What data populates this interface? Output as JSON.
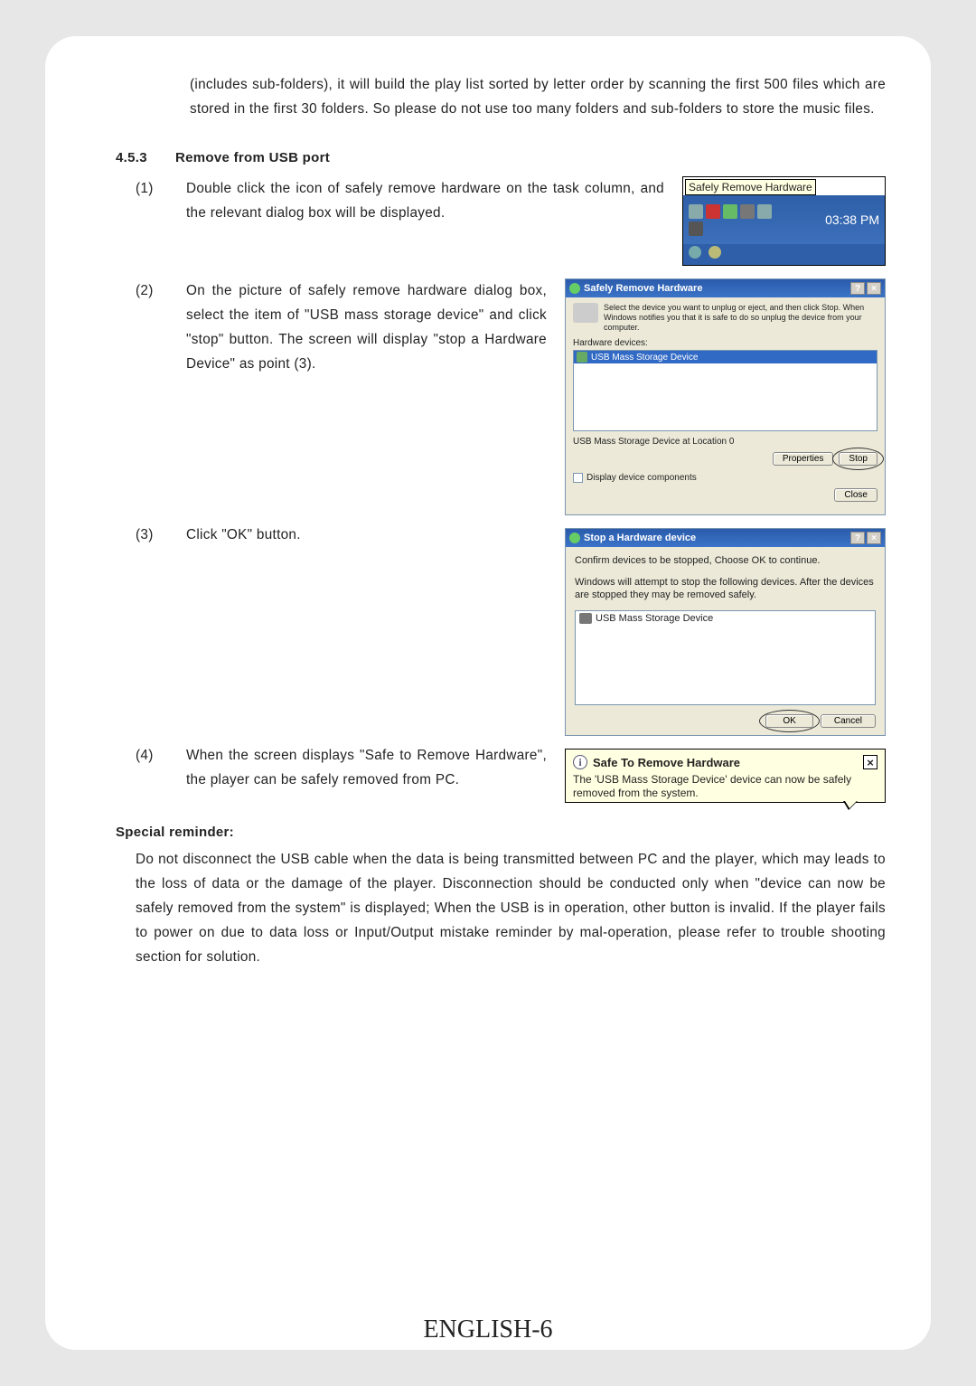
{
  "intro": "(includes sub-folders), it will build the play list sorted by letter order by scanning the first 500 files which are stored in the first 30 folders. So please do not use too many folders and sub-folders to store the music files.",
  "section": {
    "num": "4.5.3",
    "title": "Remove from USB port"
  },
  "steps": {
    "s1_num": "(1)",
    "s1": "Double click the icon of safely remove hardware on the task column, and the relevant dialog box will be displayed.",
    "s2_num": "(2)",
    "s2": "On the picture of safely remove hardware dialog box, select the item of \"USB mass storage device\" and click \"stop\" button. The screen will display \"stop a Hardware Device\" as point (3).",
    "s3_num": "(3)",
    "s3": "Click \"OK\" button.",
    "s4_num": "(4)",
    "s4": "When the screen displays \"Safe to Remove Hardware\", the player can be safely removed from PC."
  },
  "tray": {
    "tooltip": "Safely Remove Hardware",
    "clock": "03:38 PM"
  },
  "srh": {
    "title": "Safely Remove Hardware",
    "help": "Select the device you want to unplug or eject, and then click Stop. When Windows notifies you that it is safe to do so unplug the device from your computer.",
    "label": "Hardware devices:",
    "item": "USB Mass Storage Device",
    "status": "USB Mass Storage Device at Location 0",
    "btn_properties": "Properties",
    "btn_stop": "Stop",
    "checkbox": "Display device components",
    "btn_close": "Close",
    "help_btn": "?",
    "close_x": "×"
  },
  "stop": {
    "title": "Stop a Hardware device",
    "line1": "Confirm devices to be stopped, Choose OK to continue.",
    "line2": "Windows will attempt to stop the following devices. After the devices are stopped they may be removed safely.",
    "item": "USB Mass Storage Device",
    "btn_ok": "OK",
    "btn_cancel": "Cancel",
    "help_btn": "?",
    "close_x": "×"
  },
  "balloon": {
    "title": "Safe To Remove Hardware",
    "text": "The 'USB Mass Storage Device' device can now be safely removed from the system.",
    "close_x": "×",
    "i": "i"
  },
  "special": {
    "heading": "Special reminder:",
    "body": "Do not disconnect the USB cable when the data is being transmitted between PC and the player, which may leads to the loss of data or the damage of the player. Disconnection should be conducted only when \"device can now be safely removed from the system\" is displayed; When the USB is in operation, other button is invalid. If the player fails to power on due to data loss or Input/Output mistake reminder by mal-operation, please refer to trouble shooting section for solution."
  },
  "footer": "ENGLISH-6"
}
